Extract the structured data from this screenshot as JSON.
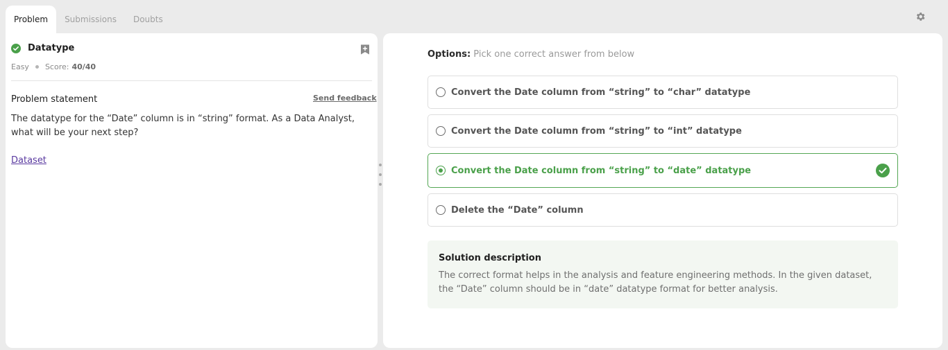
{
  "tabs": [
    {
      "label": "Problem",
      "active": true
    },
    {
      "label": "Submissions",
      "active": false
    },
    {
      "label": "Doubts",
      "active": false
    }
  ],
  "icons": {
    "settings": "gear-icon",
    "bookmark": "bookmark-plus-icon",
    "solved": "check-circle-icon"
  },
  "problem": {
    "title": "Datatype",
    "difficulty": "Easy",
    "score_label": "Score:",
    "score_value": "40/40",
    "statement_heading": "Problem statement",
    "feedback_link": "Send feedback",
    "statement_text": "The datatype for the “Date” column is in “string” format. As a Data Analyst, what will be your next step?",
    "dataset_link": "Dataset"
  },
  "options": {
    "label_bold": "Options:",
    "label_hint": "Pick one correct answer from below",
    "items": [
      {
        "text": "Convert the Date column from “string” to “char” datatype",
        "correct": false
      },
      {
        "text": "Convert the Date column from “string” to “int” datatype",
        "correct": false
      },
      {
        "text": "Convert the Date column from “string” to “date” datatype",
        "correct": true
      },
      {
        "text": "Delete the “Date” column",
        "correct": false
      }
    ]
  },
  "solution": {
    "title": "Solution description",
    "text": "The correct format helps in the analysis and feature engineering methods. In the given dataset, the “Date” column should be in “date” datatype format for better analysis."
  },
  "colors": {
    "success": "#4aa04a",
    "background": "#ebebeb",
    "panel": "#ffffff"
  }
}
